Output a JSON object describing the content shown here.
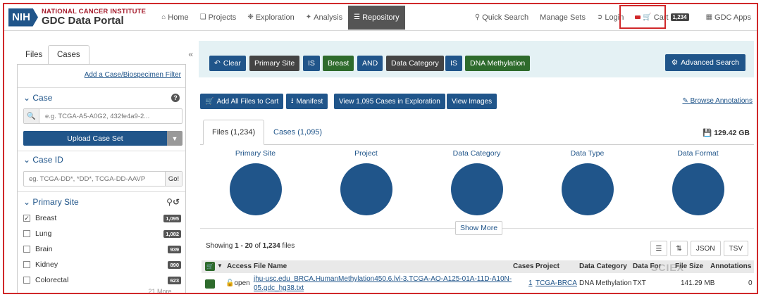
{
  "header": {
    "logo_badge": "NIH",
    "logo_org": "NATIONAL CANCER INSTITUTE",
    "logo_title": "GDC Data Portal",
    "nav": [
      {
        "label": "Home",
        "icon": "home-icon"
      },
      {
        "label": "Projects",
        "icon": "projects-icon"
      },
      {
        "label": "Exploration",
        "icon": "exploration-icon"
      },
      {
        "label": "Analysis",
        "icon": "analysis-icon"
      },
      {
        "label": "Repository",
        "icon": "database-icon",
        "active": true
      }
    ],
    "right": {
      "quick_search": "Quick Search",
      "manage_sets": "Manage Sets",
      "login": "Login",
      "cart_label": "Cart",
      "cart_count": "1,234",
      "gdc_apps": "GDC Apps"
    }
  },
  "sidebar": {
    "tabs": [
      "Files",
      "Cases"
    ],
    "active_tab": "Cases",
    "add_filter": "Add a Case/Biospecimen Filter",
    "case_title": "Case",
    "case_placeholder": "e.g. TCGA-A5-A0G2, 432fe4a9-2...",
    "upload_label": "Upload Case Set",
    "caseid_title": "Case ID",
    "caseid_placeholder": "eg. TCGA-DD*, *DD*, TCGA-DD-AAVP",
    "go_label": "Go!",
    "primary_site_title": "Primary Site",
    "primary_site": [
      {
        "label": "Breast",
        "count": "1,095",
        "checked": true
      },
      {
        "label": "Lung",
        "count": "1,082",
        "checked": false
      },
      {
        "label": "Brain",
        "count": "939",
        "checked": false
      },
      {
        "label": "Kidney",
        "count": "890",
        "checked": false
      },
      {
        "label": "Colorectal",
        "count": "623",
        "checked": false
      }
    ],
    "more": "21 More..."
  },
  "query": {
    "clear": "Clear",
    "chips": [
      {
        "label": "Primary Site",
        "kind": "field"
      },
      {
        "label": "IS",
        "kind": "op"
      },
      {
        "label": "Breast",
        "kind": "value"
      },
      {
        "label": "AND",
        "kind": "op"
      },
      {
        "label": "Data Category",
        "kind": "field"
      },
      {
        "label": "IS",
        "kind": "op"
      },
      {
        "label": "DNA Methylation",
        "kind": "value"
      }
    ],
    "advanced": "Advanced Search",
    "colors": {
      "op": "#20558a",
      "field": "#444444",
      "value": "#2e6b2c"
    }
  },
  "actions": {
    "add_all": "Add All Files to Cart",
    "manifest": "Manifest",
    "view_cases": "View 1,095 Cases in Exploration",
    "view_images": "View Images",
    "browse_annotations": "Browse Annotations"
  },
  "results": {
    "tabs": [
      "Files (1,234)",
      "Cases (1,095)"
    ],
    "active_tab": "Files (1,234)",
    "total_size": "129.42 GB",
    "pies": [
      "Primary Site",
      "Project",
      "Data Category",
      "Data Type",
      "Data Format"
    ],
    "show_more": "Show More",
    "showing_prefix": "Showing ",
    "showing_range": "1 - 20",
    "showing_mid": " of ",
    "showing_total": "1,234",
    "showing_suffix": " files",
    "tools": [
      "JSON",
      "TSV"
    ],
    "columns": [
      "Access",
      "File Name",
      "Cases",
      "Project",
      "Data Category",
      "Data Format",
      "File Size",
      "Annotations"
    ],
    "rows": [
      {
        "access": "open",
        "file_name_line1": "jhu-usc.edu_BRCA.HumanMethylation450.6.lvl-3.TCGA-AO-A125-01A-11D-A10N-",
        "file_name_line2": "05.gdc_hg38.txt",
        "cases": "1",
        "project": "TCGA-BRCA",
        "data_category": "DNA Methylation",
        "data_format": "TXT",
        "file_size": "141.29 MB",
        "annotations": "0"
      }
    ]
  },
  "watermark": "SCIEX",
  "colors": {
    "brand_blue": "#20558a",
    "highlight_red": "#d0282a",
    "nci_red": "#a51d2d"
  }
}
